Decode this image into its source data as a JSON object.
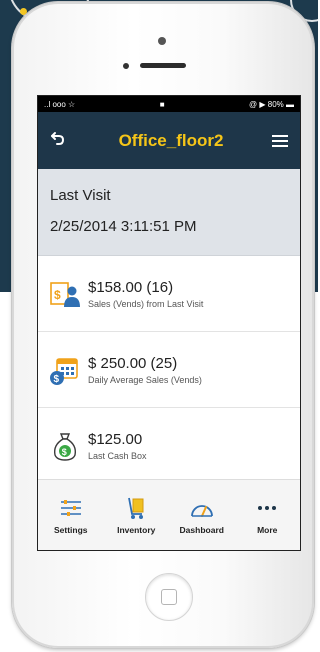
{
  "status_bar": {
    "carrier": "..l ooo ☆",
    "lock": "■",
    "battery": "@ ▶ 80% ▬"
  },
  "header": {
    "title": "Office_floor2",
    "back_icon": "back-arrow-icon",
    "menu_icon": "hamburger-menu-icon"
  },
  "last_visit": {
    "label": "Last Visit",
    "datetime": "2/25/2014 3:11:51 PM"
  },
  "metrics": [
    {
      "value": "$158.00 (16)",
      "description": "Sales (Vends) from Last Visit",
      "icon": "sales-person-icon"
    },
    {
      "value": "$ 250.00 (25)",
      "description": "Daily Average Sales (Vends)",
      "icon": "calendar-dollar-icon"
    },
    {
      "value": "$125.00",
      "description": "Last Cash Box",
      "icon": "money-bag-icon"
    }
  ],
  "tabs": [
    {
      "label": "Settings",
      "icon": "settings-sliders-icon"
    },
    {
      "label": "Inventory",
      "icon": "inventory-cart-icon"
    },
    {
      "label": "Dashboard",
      "icon": "dashboard-gauge-icon"
    },
    {
      "label": "More",
      "icon": "more-dots-icon"
    }
  ],
  "colors": {
    "header_bg": "#1e3649",
    "title_accent": "#f5c518",
    "last_visit_bg": "#dfe3e8",
    "backdrop": "#1d3a4d"
  }
}
